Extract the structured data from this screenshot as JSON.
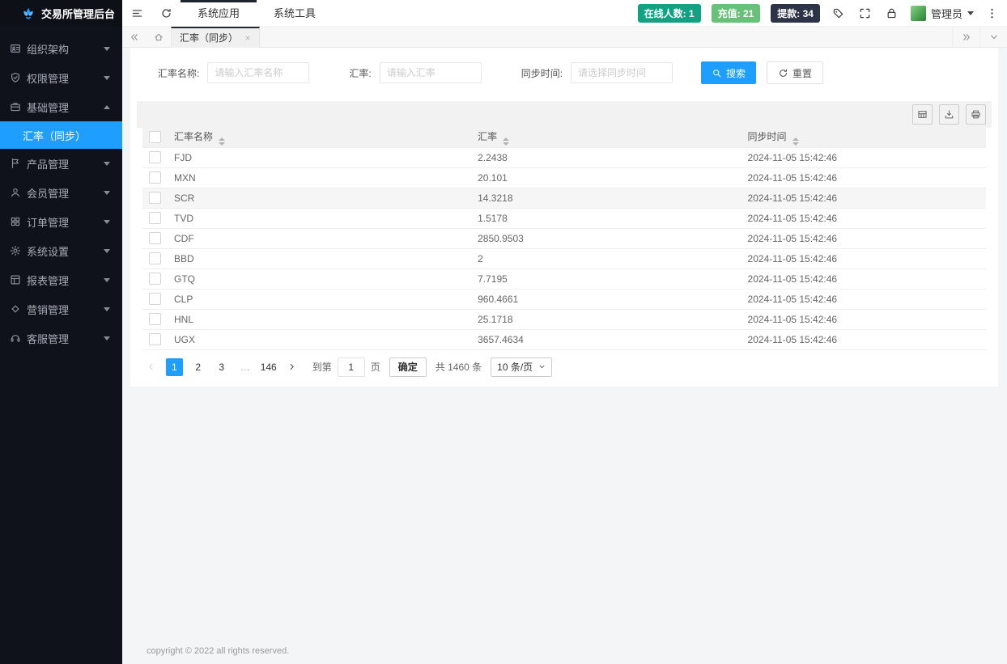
{
  "app": {
    "title": "交易所管理后台"
  },
  "sidebar": {
    "items": [
      {
        "id": "org",
        "icon": "org",
        "label": "组织架构"
      },
      {
        "id": "permission",
        "icon": "shield",
        "label": "权限管理"
      },
      {
        "id": "base",
        "icon": "case",
        "label": "基础管理",
        "expanded": true,
        "children": [
          {
            "id": "exchange-rate-sync",
            "label": "汇率（同步）",
            "active": true
          }
        ]
      },
      {
        "id": "product",
        "icon": "flag",
        "label": "产品管理"
      },
      {
        "id": "member",
        "icon": "user",
        "label": "会员管理"
      },
      {
        "id": "order",
        "icon": "grid",
        "label": "订单管理"
      },
      {
        "id": "settings",
        "icon": "gear",
        "label": "系统设置"
      },
      {
        "id": "report",
        "icon": "report",
        "label": "报表管理"
      },
      {
        "id": "marketing",
        "icon": "diamond",
        "label": "营销管理"
      },
      {
        "id": "service",
        "icon": "service",
        "label": "客服管理"
      }
    ]
  },
  "header": {
    "nav": [
      {
        "id": "apps",
        "label": "系统应用",
        "active": true
      },
      {
        "id": "tools",
        "label": "系统工具",
        "active": false
      }
    ],
    "badges": [
      {
        "id": "online-count",
        "label": "在线人数: 1",
        "bg": "#13a184"
      },
      {
        "id": "deposit",
        "label": "充值: 21",
        "bg": "#67c178"
      },
      {
        "id": "withdraw",
        "label": "提款: 34",
        "bg": "#2e3447"
      }
    ],
    "icons": [
      "tag",
      "fullscreen",
      "lock"
    ],
    "user": {
      "name": "管理员"
    }
  },
  "tabbar": {
    "tabs": [
      {
        "id": "exchange-rate-sync",
        "label": "汇率（同步）",
        "active": true
      }
    ]
  },
  "search": {
    "fields": [
      {
        "id": "rate-name",
        "label": "汇率名称:",
        "placeholder": "请输入汇率名称",
        "value": ""
      },
      {
        "id": "rate",
        "label": "汇率:",
        "placeholder": "请输入汇率",
        "value": ""
      },
      {
        "id": "sync-time",
        "label": "同步时间:",
        "placeholder": "请选择同步时间",
        "value": ""
      }
    ],
    "search_label": "搜索",
    "reset_label": "重置"
  },
  "toolbar": {
    "icons": [
      "columns",
      "export",
      "print"
    ]
  },
  "table": {
    "columns": [
      {
        "label": "汇率名称"
      },
      {
        "label": "汇率"
      },
      {
        "label": "同步时间"
      }
    ],
    "rows": [
      {
        "name": "FJD",
        "rate": "2.2438",
        "time": "2024-11-05 15:42:46"
      },
      {
        "name": "MXN",
        "rate": "20.101",
        "time": "2024-11-05 15:42:46"
      },
      {
        "name": "SCR",
        "rate": "14.3218",
        "time": "2024-11-05 15:42:46",
        "highlighted": true
      },
      {
        "name": "TVD",
        "rate": "1.5178",
        "time": "2024-11-05 15:42:46"
      },
      {
        "name": "CDF",
        "rate": "2850.9503",
        "time": "2024-11-05 15:42:46"
      },
      {
        "name": "BBD",
        "rate": "2",
        "time": "2024-11-05 15:42:46"
      },
      {
        "name": "GTQ",
        "rate": "7.7195",
        "time": "2024-11-05 15:42:46"
      },
      {
        "name": "CLP",
        "rate": "960.4661",
        "time": "2024-11-05 15:42:46"
      },
      {
        "name": "HNL",
        "rate": "25.1718",
        "time": "2024-11-05 15:42:46"
      },
      {
        "name": "UGX",
        "rate": "3657.4634",
        "time": "2024-11-05 15:42:46"
      }
    ]
  },
  "pagination": {
    "pages": [
      {
        "label": "1",
        "active": true
      },
      {
        "label": "2"
      },
      {
        "label": "3"
      },
      {
        "label": "…",
        "ellipsis": true
      },
      {
        "label": "146"
      }
    ],
    "goto_label": "到第",
    "goto_value": "1",
    "page_unit": "页",
    "confirm_label": "确定",
    "total": "共 1460 条",
    "page_size": "10 条/页"
  },
  "footer": {
    "copyright": "copyright © 2022 all rights reserved."
  }
}
